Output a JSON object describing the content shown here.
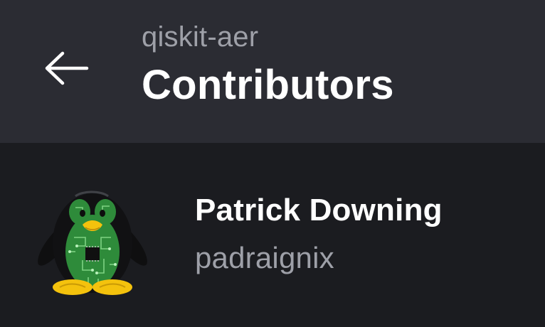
{
  "header": {
    "back_icon": "arrow-left-icon",
    "repo_name": "qiskit-aer",
    "title": "Contributors"
  },
  "contributors": [
    {
      "name": "Patrick Downing",
      "login": "padraignix",
      "avatar_icon": "tux-penguin-circuit-avatar"
    }
  ],
  "colors": {
    "header_bg": "#2b2c33",
    "body_bg": "#1b1c20",
    "primary_text": "#ffffff",
    "secondary_text": "#9ea0a8",
    "avatar_circuit_green": "#2e8b3a",
    "avatar_beak_yellow": "#f4c20d"
  }
}
